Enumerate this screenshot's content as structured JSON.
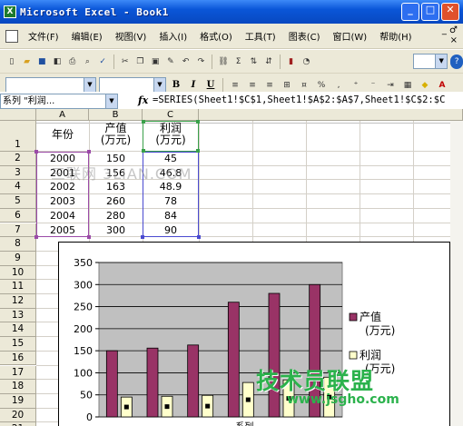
{
  "window": {
    "title": "Microsoft Excel - Book1",
    "app_icon": "X"
  },
  "menu": {
    "items": [
      "文件(F)",
      "编辑(E)",
      "视图(V)",
      "插入(I)",
      "格式(O)",
      "工具(T)",
      "图表(C)",
      "窗口(W)",
      "帮助(H)"
    ],
    "right_top": "_ ♂",
    "right_bottom": "×"
  },
  "formula_bar": {
    "name_box": "系列 \"利润...",
    "fx": "fx",
    "formula": "=SERIES(Sheet1!$C$1,Sheet1!$A$2:$A$7,Sheet1!$C$2:$C$7,2)"
  },
  "toolbar": {
    "zoom_hint": "?"
  },
  "columns": [
    "A",
    "B",
    "C"
  ],
  "rows": [
    "1",
    "2",
    "3",
    "4",
    "5",
    "6",
    "7",
    "8",
    "9",
    "10",
    "11",
    "12",
    "13",
    "14",
    "15",
    "16",
    "17",
    "18",
    "19",
    "20",
    "21"
  ],
  "table": {
    "headers": [
      "年份",
      "产值\n(万元)",
      "利润\n(万元)"
    ],
    "data": [
      [
        "2000",
        "150",
        "45"
      ],
      [
        "2001",
        "156",
        "46.8"
      ],
      [
        "2002",
        "163",
        "48.9"
      ],
      [
        "2003",
        "260",
        "78"
      ],
      [
        "2004",
        "280",
        "84"
      ],
      [
        "2005",
        "300",
        "90"
      ]
    ]
  },
  "chart_data": {
    "type": "bar",
    "categories": [
      "2000",
      "2001",
      "2002",
      "2003",
      "2004",
      "2005"
    ],
    "series": [
      {
        "name": "产值\n(万元)",
        "values": [
          150,
          156,
          163,
          260,
          280,
          300
        ],
        "color": "#993366"
      },
      {
        "name": "利润\n(万元)",
        "values": [
          45,
          46.8,
          48.9,
          78,
          84,
          90
        ],
        "color": "#ffffcc"
      }
    ],
    "yticks": [
      "350",
      "300",
      "250",
      "200",
      "150",
      "100",
      "50",
      "0"
    ],
    "ylim": [
      0,
      350
    ],
    "grid": true,
    "legend": "right",
    "plot_bg": "#c0c0c0",
    "selected_series_label": "系列"
  },
  "watermarks": {
    "top": "三联网 3LIAN.COM",
    "brand": "技术员联盟",
    "url": "www.jsgho.com"
  }
}
